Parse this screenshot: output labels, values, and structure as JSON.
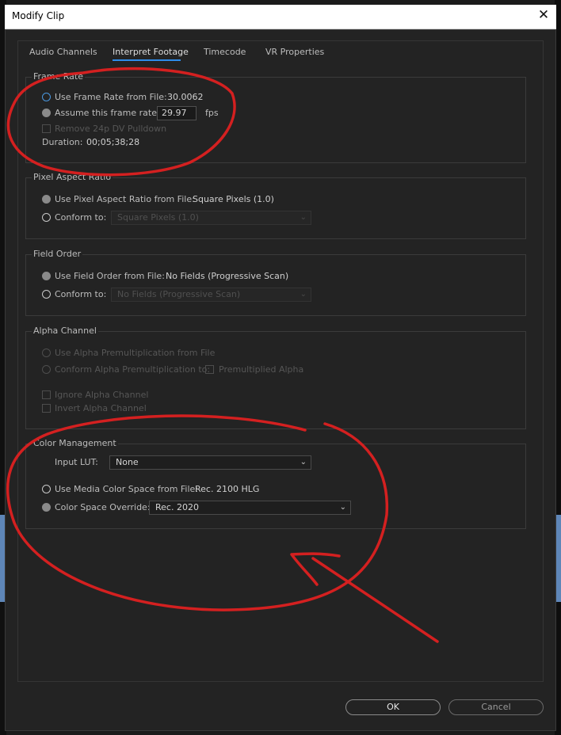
{
  "window": {
    "title": "Modify Clip",
    "close_glyph": "✕"
  },
  "tabs": [
    {
      "label": "Audio Channels",
      "active": false
    },
    {
      "label": "Interpret Footage",
      "active": true
    },
    {
      "label": "Timecode",
      "active": false
    },
    {
      "label": "VR Properties",
      "active": false
    }
  ],
  "frame_rate": {
    "title": "Frame Rate",
    "use_from_file_label": "Use Frame Rate from File:",
    "use_from_file_value": "30.0062",
    "assume_label": "Assume this frame rate:",
    "assume_value": "29.97",
    "assume_unit": "fps",
    "pulldown_label": "Remove 24p DV Pulldown",
    "duration_label": "Duration:",
    "duration_value": "00;05;38;28"
  },
  "pixel_aspect": {
    "title": "Pixel Aspect Ratio",
    "use_from_file_label": "Use Pixel Aspect Ratio from File:",
    "use_from_file_value": "Square Pixels (1.0)",
    "conform_label": "Conform to:",
    "conform_value": "Square Pixels (1.0)"
  },
  "field_order": {
    "title": "Field Order",
    "use_from_file_label": "Use Field Order from File:",
    "use_from_file_value": "No Fields (Progressive Scan)",
    "conform_label": "Conform to:",
    "conform_value": "No Fields (Progressive Scan)"
  },
  "alpha": {
    "title": "Alpha Channel",
    "use_premult_label": "Use Alpha Premultiplication from File",
    "conform_premult_label": "Conform Alpha Premultiplication to:",
    "premultiplied_label": "Premultiplied Alpha",
    "ignore_label": "Ignore Alpha Channel",
    "invert_label": "Invert Alpha Channel"
  },
  "color_management": {
    "title": "Color Management",
    "input_lut_label": "Input LUT:",
    "input_lut_value": "None",
    "use_media_label": "Use Media Color Space from File:",
    "use_media_value": "Rec. 2100 HLG",
    "override_label": "Color Space Override:",
    "override_value": "Rec. 2020"
  },
  "buttons": {
    "ok": "OK",
    "cancel": "Cancel"
  },
  "colors": {
    "annotation": "#d42020",
    "tab_accent": "#2d8ceb",
    "radio_selected": "#4a98e0"
  }
}
